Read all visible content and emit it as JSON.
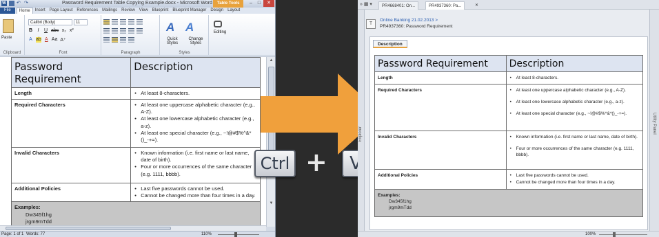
{
  "word": {
    "title": "Password Requirement Table Copying Example.docx - Microsoft Word",
    "table_tools": "Table Tools",
    "ribbon_tabs": [
      "File",
      "Home",
      "Insert",
      "Page Layout",
      "References",
      "Mailings",
      "Review",
      "View",
      "Blueprint",
      "Blueprint Manager",
      "Design",
      "Layout"
    ],
    "active_tab": "Home",
    "font_name": "Calibri (Body)",
    "font_size": "11",
    "paste_label": "Paste",
    "groups": {
      "clipboard": "Clipboard",
      "font": "Font",
      "paragraph": "Paragraph",
      "styles": "Styles"
    },
    "quick_styles": "Quick Styles",
    "change_styles": "Change Styles",
    "editing": "Editing",
    "status": {
      "page": "Page: 1 of 1",
      "words": "Words: 77",
      "zoom": "110%"
    }
  },
  "table": {
    "headers": [
      "Password Requirement",
      "Description"
    ],
    "rows": [
      {
        "name": "Length",
        "items": [
          "At least 8-characters."
        ]
      },
      {
        "name": "Required Characters",
        "items": [
          "At least one uppercase alphabetic character (e.g., A-Z).",
          "At least one lowercase alphabetic character (e.g., a-z).",
          "At least one special character (e.g., ~!@#$%^&*()_-+=)."
        ]
      },
      {
        "name": "Invalid Characters",
        "items": [
          "Known information (i.e. first name or last name, date of birth).",
          "Four or more occurrences of the same character (e.g. 1111, bbbb)."
        ]
      },
      {
        "name": "Additional Policies",
        "items": [
          "Last five passwords cannot be used.",
          "Cannot be changed more than four times in a day."
        ]
      }
    ],
    "examples_label": "Examples:",
    "examples": [
      "Dw345f1hg",
      "jrgm9mTdd"
    ]
  },
  "keys": {
    "ctrl": "Ctrl",
    "plus": "+",
    "v": "V"
  },
  "browser": {
    "tabs": [
      "PR4668401: On...",
      "PR4937360: Pa..."
    ],
    "breadcrumb_link": "Online Banking 21.02.2013 >",
    "breadcrumb_item": "PR4937360: Password Requirement",
    "description_tab": "Description",
    "left_panel": "Explorer",
    "right_panel": "Utility Panel",
    "zoom": "100%"
  },
  "colors": {
    "arrow": "#f0a03c",
    "word_accent": "#2b5797",
    "table_header": "#dde4f1",
    "examples_bg": "#c6c6c6"
  }
}
